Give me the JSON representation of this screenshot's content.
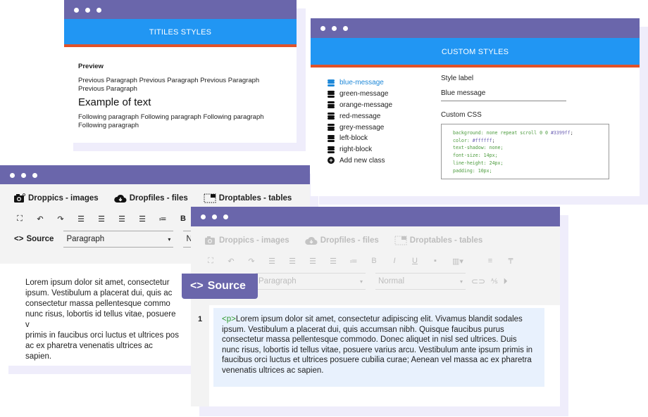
{
  "titles_window": {
    "header": "TITILES STYLES",
    "preview_label": "Preview",
    "previous_paragraph": "Previous Paragraph Previous Paragraph Previous Paragraph Previous Paragraph",
    "example_heading": "Example of text",
    "following_paragraph": "Following paragraph Following paragraph Following paragraph Following paragraph"
  },
  "custom_styles_window": {
    "header": "CUSTOM STYLES",
    "classes": [
      {
        "label": "blue-message",
        "icon": "database-icon",
        "active": true
      },
      {
        "label": "green-message",
        "icon": "database-icon"
      },
      {
        "label": "orange-message",
        "icon": "database-icon"
      },
      {
        "label": "red-message",
        "icon": "database-icon"
      },
      {
        "label": "grey-message",
        "icon": "database-icon"
      },
      {
        "label": "left-block",
        "icon": "database-icon"
      },
      {
        "label": "right-block",
        "icon": "database-icon"
      }
    ],
    "add_class_label": "Add new class",
    "style_label_title": "Style label",
    "style_label_value": "Blue message",
    "custom_css_title": "Custom CSS",
    "css_lines": [
      {
        "prop": "background: none repeat scroll 0 0 ",
        "val": "#3399ff",
        "end": ";"
      },
      {
        "prop": "color: ",
        "val": "#ffffff",
        "end": ";"
      },
      {
        "prop": "text-shadow: none;",
        "val": "",
        "end": ""
      },
      {
        "prop": "font-size: 14px;",
        "val": "",
        "end": ""
      },
      {
        "prop": "line-height: 24px;",
        "val": "",
        "end": ""
      },
      {
        "prop": "padding: 10px;",
        "val": "",
        "end": ""
      }
    ]
  },
  "editor": {
    "plugins": {
      "droppics": "Droppics - images",
      "dropfiles": "Dropfiles - files",
      "droptables": "Droptables - tables"
    },
    "source_label": "Source",
    "format_select": "Paragraph",
    "size_select_partial": "N",
    "size_select": "Normal",
    "bold_label": "B",
    "italic_label": "I",
    "underline_label": "U",
    "content": "Lorem ipsum dolor sit amet, consectetur adipiscing elit. Vivamus blandit sodales ipsum. Vestibulum a placerat dui, quis accumsan nibh. Quisque faucibus purus consectetur massa pellentesque commodo. Donec aliquet in nisl sed ultrices. Duis nunc risus, lobortis id tellus vitae, posuere varius arcu. Vestibulum ante ipsum primis in faucibus orci luctus et ultrices posuere cubilia curae; Aenean vel massa ac ex pharetra venenatis ultrices ac sapien.",
    "back_content_lines": [
      "Lorem ipsum dolor sit amet, consectetur",
      "ipsum. Vestibulum a placerat dui, quis ac",
      "consectetur massa pellentesque commo",
      "nunc risus, lobortis id tellus vitae, posuere v",
      "primis in faucibus orci luctus et ultrices pos",
      "ac ex pharetra venenatis ultrices ac sapien."
    ],
    "line_number": "1",
    "code_open_tag": "<p>"
  },
  "colors": {
    "titlebar": "#6a66ab",
    "header_blue": "#2196f3",
    "header_accent": "#e0522a",
    "active_class": "#1e88d8",
    "code_bg": "#e8f1fd"
  }
}
